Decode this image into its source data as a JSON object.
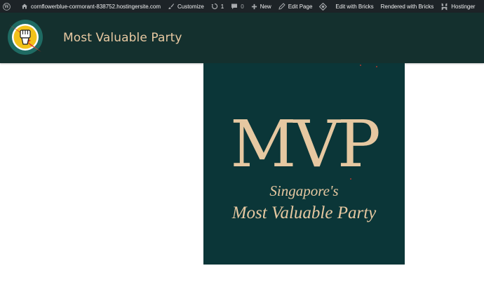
{
  "adminbar": {
    "site_url": "cornflowerblue-cormorant-838752.hostingersite.com",
    "customize": "Customize",
    "updates_count": "1",
    "comments_count": "0",
    "new": "New",
    "edit_page": "Edit Page",
    "edit_with_bricks": "Edit with Bricks",
    "rendered_with_bricks": "Rendered with Bricks",
    "hostinger": "Hostinger"
  },
  "header": {
    "site_title": "Most Valuable Party"
  },
  "hero": {
    "logo_text": "MVP",
    "tagline_line1": "Singapore's",
    "tagline_line2": "Most Valuable Party"
  },
  "colors": {
    "adminbar_bg": "#1d2327",
    "header_bg": "#14302e",
    "hero_bg": "#0b3638",
    "accent_gold": "#e6c8a1",
    "logo_ring": "#1f6b63",
    "logo_fill": "#f2c21a",
    "logo_bolt": "#e03a2a"
  },
  "icons": [
    "wordpress-icon",
    "home-icon",
    "paintbrush-icon",
    "updates-icon",
    "comment-icon",
    "plus-icon",
    "pencil-icon",
    "bricks-icon",
    "hostinger-icon",
    "fist-icon",
    "lightning-icon"
  ]
}
